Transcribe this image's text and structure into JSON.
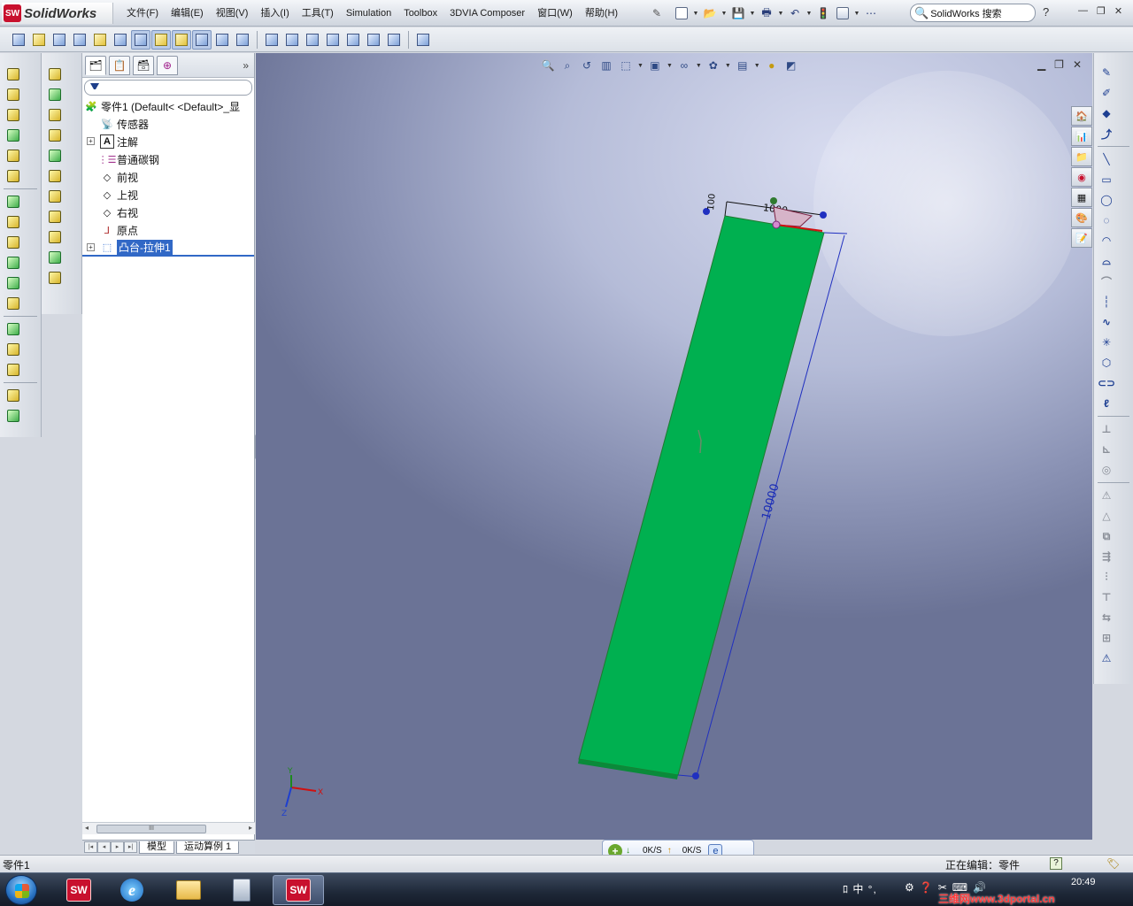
{
  "app": {
    "logo_badge": "SW",
    "logo_text": "SolidWorks",
    "menus": [
      "文件(F)",
      "编辑(E)",
      "视图(V)",
      "插入(I)",
      "工具(T)",
      "Simulation",
      "Toolbox",
      "3DVIA Composer",
      "窗口(W)",
      "帮助(H)"
    ],
    "search_placeholder": "SolidWorks 搜索",
    "help_label": "?"
  },
  "tree": {
    "root_label": "零件1  (Default< <Default>_显",
    "items": [
      {
        "label": "传感器",
        "expandable": false,
        "icon": "sensor-icon"
      },
      {
        "label": "注解",
        "expandable": true,
        "icon": "annotation-icon"
      },
      {
        "label": "普通碳钢",
        "expandable": false,
        "icon": "material-icon"
      },
      {
        "label": "前视",
        "expandable": false,
        "icon": "plane-icon"
      },
      {
        "label": "上视",
        "expandable": false,
        "icon": "plane-icon"
      },
      {
        "label": "右视",
        "expandable": false,
        "icon": "plane-icon"
      },
      {
        "label": "原点",
        "expandable": false,
        "icon": "origin-icon"
      },
      {
        "label": "凸台-拉伸1",
        "expandable": true,
        "icon": "extrude-icon",
        "selected": true
      }
    ],
    "scroll_thumb_label": "III"
  },
  "bottom_tabs": [
    "模型",
    "运动算例 1"
  ],
  "viewport": {
    "dim_length": "10000",
    "dim_width": "1000",
    "dim_thickness": "100",
    "triad_x": "X",
    "triad_y": "Y",
    "triad_z": "Z",
    "part_color": "#00b050"
  },
  "status": {
    "left": "零件1",
    "editing": "正在编辑：零件",
    "help_icon": "?"
  },
  "net_widget": {
    "down_speed": "0K/S",
    "up_speed": "0K/S"
  },
  "taskbar": {
    "ime": "ﾛ 中 °, ",
    "clock": "20:49",
    "watermark": "三维网www.3dportal.cn"
  }
}
